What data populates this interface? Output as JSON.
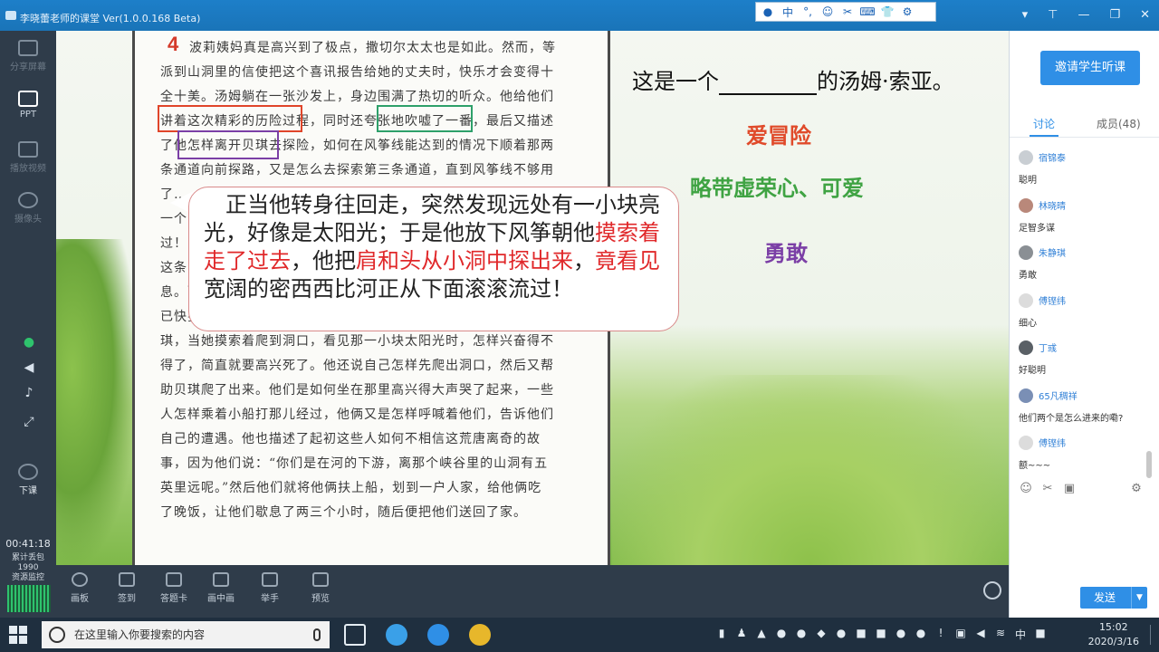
{
  "app": {
    "title": "李晓蕾老师的课堂 Ver(1.0.0.168 Beta)"
  },
  "ime_bar": {
    "items": [
      "中",
      "°,",
      "☺",
      "✂",
      "⌨",
      "👕",
      "⚙"
    ]
  },
  "left_toolbar": {
    "items": [
      {
        "label": "分享屏幕",
        "state": "dim"
      },
      {
        "label": "PPT",
        "state": "active"
      },
      {
        "label": "播放视频",
        "state": "dim"
      },
      {
        "label": "摄像头",
        "state": "dim"
      }
    ],
    "end_class_label": "下课",
    "timer": "00:41:18",
    "stats": [
      "累计丢包",
      "1990",
      "资源监控"
    ]
  },
  "book": {
    "page_number": "4",
    "lines": [
      "波莉姨妈真是高兴到了极点，撒切尔太太也是如此。然而，等",
      "派到山洞里的信使把这个喜讯报告给她的丈夫时，快乐才会变得十",
      "全十美。汤姆躺在一张沙发上，身边围满了热切的听众。他给他们",
      "讲着这次精彩的历险过程，同时还夸张地吹嘘了一番，最后又描述",
      "了他怎样离开贝琪去探险，如何在风筝线能达到的情况下顺着那两",
      "条通道向前探路，又是怎么去探索第三条通道，直到风筝线不够用",
      "了……",
      "一个",
      "过！",
      "这条",
      "息。而",
      "已快要死了，她也愿意死掉。他还讲了自己如何费尽口舌说服了贝",
      "琪，当她摸索着爬到洞口，看见那一小块太阳光时，怎样兴奋得不",
      "得了，简直就要高兴死了。他还说自己怎样先爬出洞口，然后又帮",
      "助贝琪爬了出来。他们是如何坐在那里高兴得大声哭了起来，一些",
      "人怎样乘着小船打那儿经过，他俩又是怎样呼喊着他们，告诉他们",
      "自己的遭遇。他也描述了起初这些人如何不相信这荒唐离奇的故",
      "事，因为他们说：“你们是在河的下游，离那个峡谷里的山洞有五",
      "英里远呢。”然后他们就将他俩扶上船，划到一户人家，给他俩吃",
      "了晚饭，让他们歇息了两三个小时，随后便把他们送回了家。"
    ]
  },
  "callout": {
    "parts": [
      {
        "text": "　正当他转身往回走，突然发现远处有一小块亮光，好像是太阳光；于是他放下风筝朝他",
        "hl": false
      },
      {
        "text": "摸索着走了过去",
        "hl": true
      },
      {
        "text": "，他把",
        "hl": false
      },
      {
        "text": "肩和头从小洞中探出来",
        "hl": true
      },
      {
        "text": "，",
        "hl": false
      },
      {
        "text": "竟看见",
        "hl": true
      },
      {
        "text": "宽阔的密西西比河正从下面滚滚流过！",
        "hl": false
      }
    ]
  },
  "question": {
    "before": "这是一个",
    "after": "的汤姆·索亚。"
  },
  "answers": [
    {
      "text": "爱冒险",
      "color": "#e04a2a"
    },
    {
      "text": "略带虚荣心、可爱",
      "color": "#3fa343"
    },
    {
      "text": "勇敢",
      "color": "#7b3fa6"
    }
  ],
  "bottom_toolbar": {
    "items": [
      "画板",
      "签到",
      "答题卡",
      "画中画",
      "举手",
      "预览"
    ]
  },
  "right_panel": {
    "invite_button": "邀请学生听课",
    "tabs": [
      "讨论",
      "成员(48)"
    ],
    "messages": [
      {
        "name": "宿锦泰",
        "text": "聪明"
      },
      {
        "name": "林晓晴",
        "text": "足智多谋"
      },
      {
        "name": "朱静琪",
        "text": "勇敢"
      },
      {
        "name": "傅铿纬",
        "text": "细心"
      },
      {
        "name": "丁彧",
        "text": "好聪明"
      },
      {
        "name": "65凡稠祥",
        "text": "他们两个是怎么进来的嘞?"
      },
      {
        "name": "傅铿纬",
        "text": "额~~~"
      }
    ],
    "send_button": "发送"
  },
  "taskbar": {
    "search_placeholder": "在这里输入你要搜索的内容",
    "ime": "中",
    "time": "15:02",
    "date": "2020/3/16"
  }
}
